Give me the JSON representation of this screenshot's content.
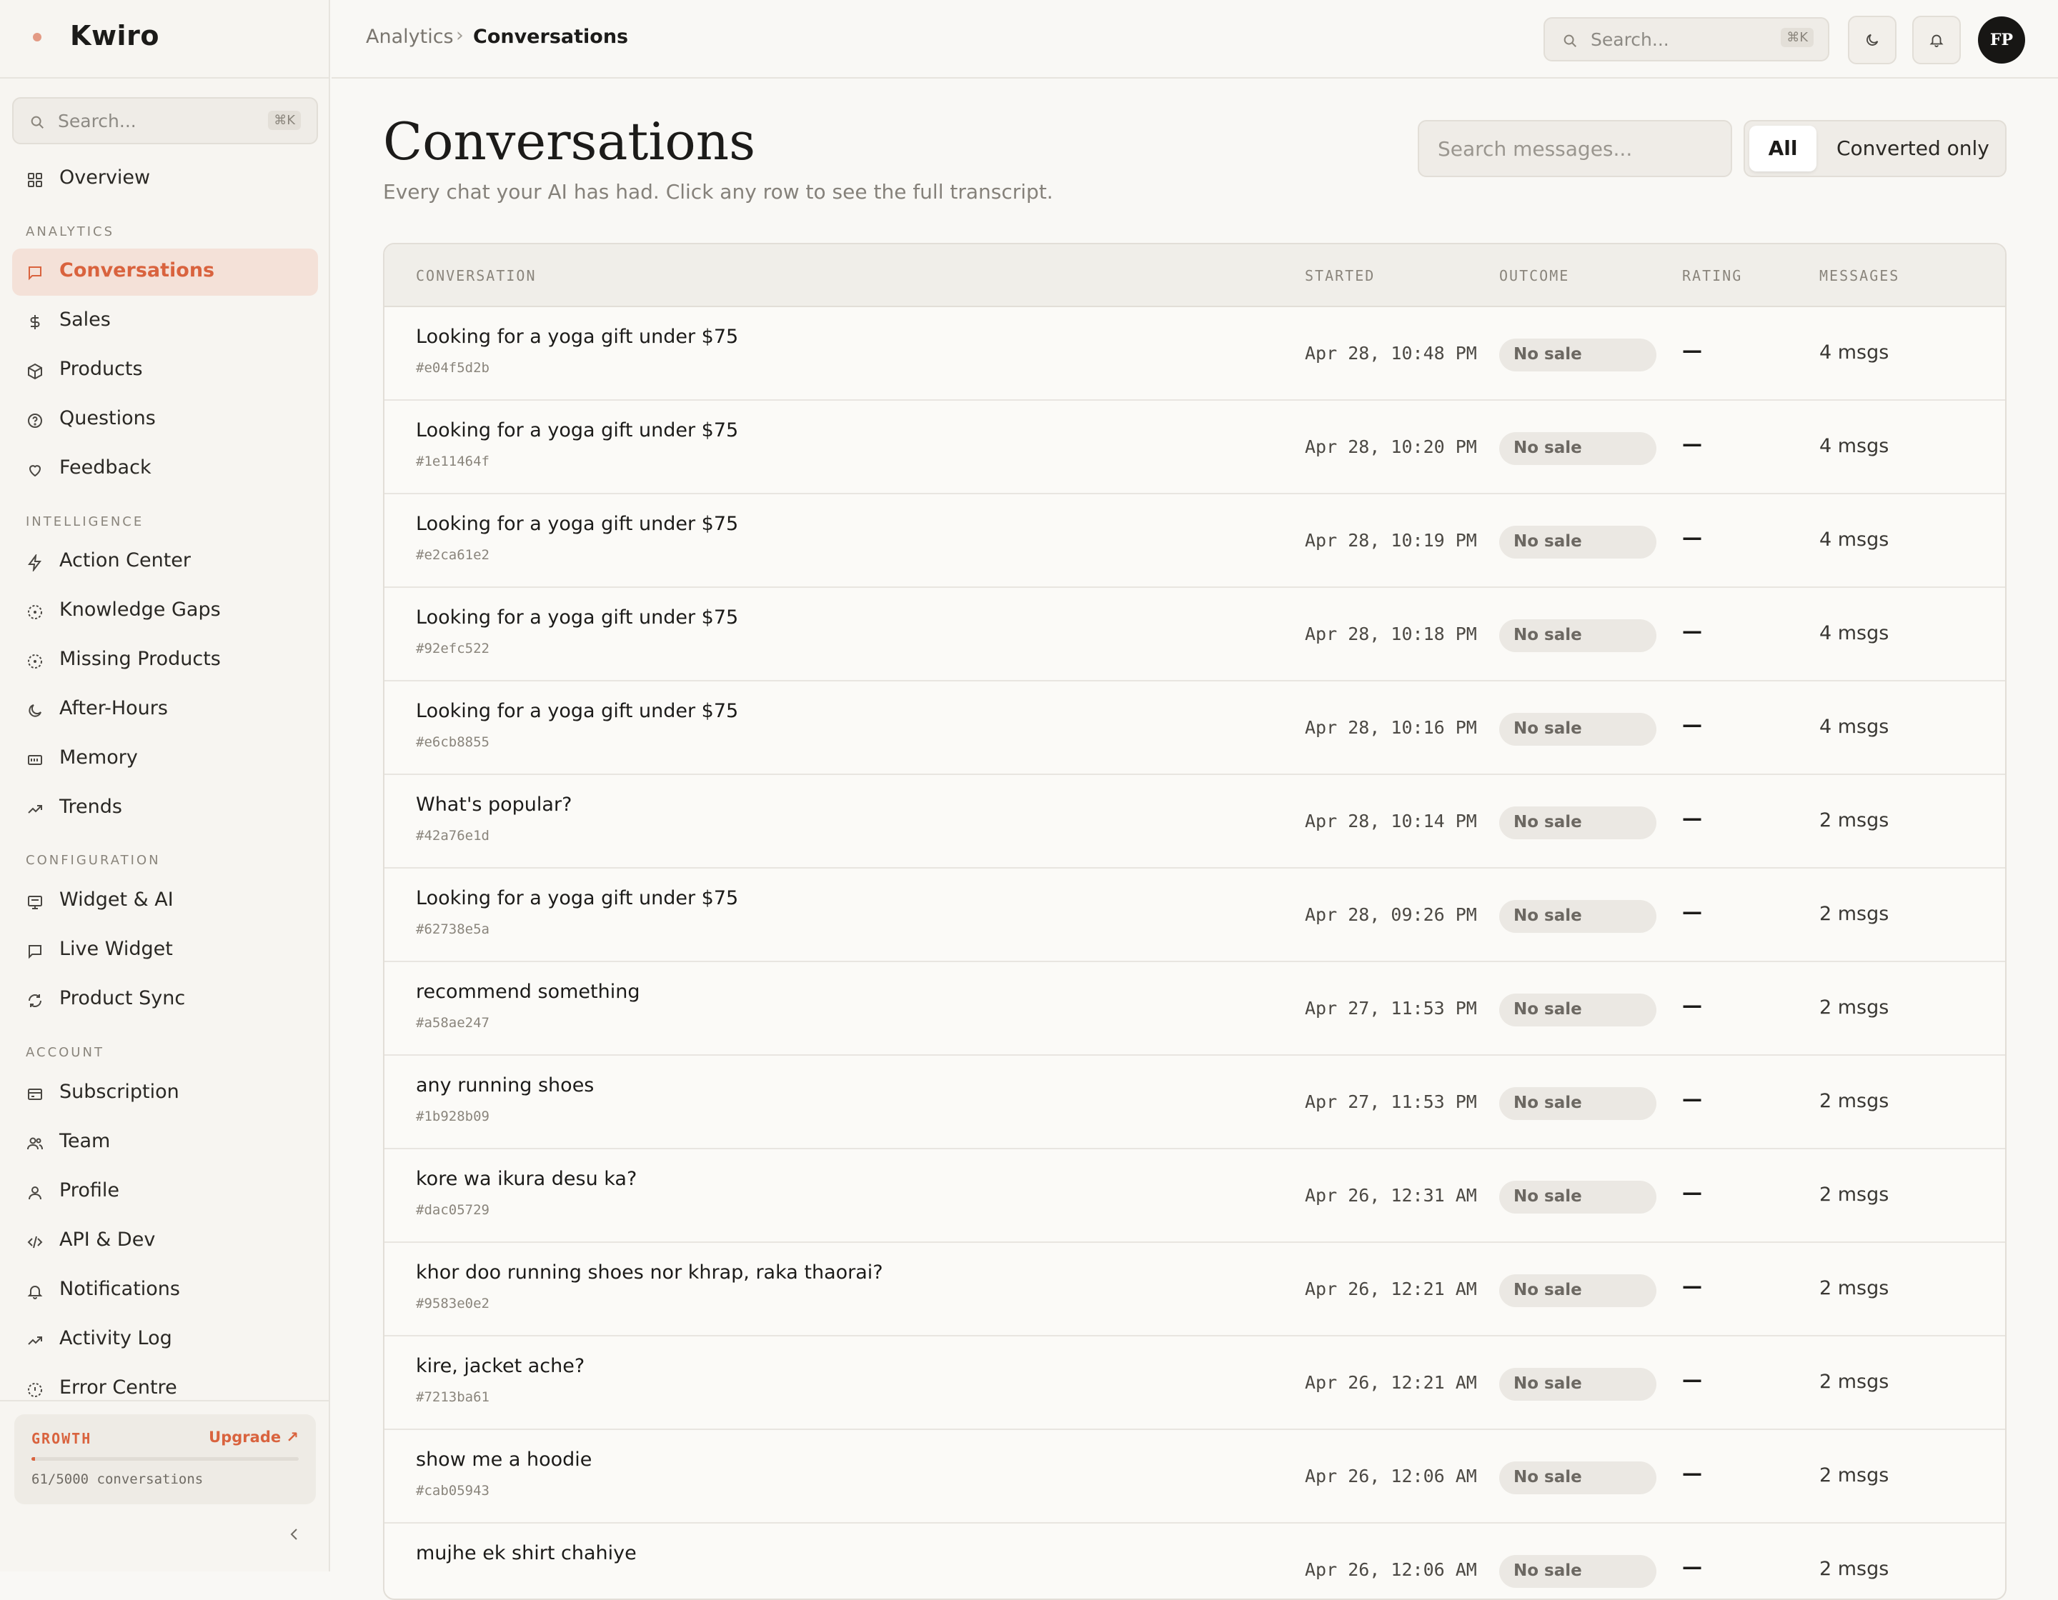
{
  "app": {
    "name": "Kwiro"
  },
  "sidebar": {
    "search": {
      "placeholder": "Search...",
      "shortcut": "⌘K"
    },
    "overview": "Overview",
    "sections": {
      "analytics": "ANALYTICS",
      "intelligence": "INTELLIGENCE",
      "configuration": "CONFIGURATION",
      "account": "ACCOUNT"
    },
    "analytics": [
      {
        "label": "Conversations",
        "icon": "message-icon"
      },
      {
        "label": "Sales",
        "icon": "dollar-icon"
      },
      {
        "label": "Products",
        "icon": "box-icon"
      },
      {
        "label": "Questions",
        "icon": "help-circle-icon"
      },
      {
        "label": "Feedback",
        "icon": "heart-icon"
      }
    ],
    "intelligence": [
      {
        "label": "Action Center",
        "icon": "bolt-icon"
      },
      {
        "label": "Knowledge Gaps",
        "icon": "gap-circle-icon"
      },
      {
        "label": "Missing Products",
        "icon": "gap-circle-icon"
      },
      {
        "label": "After-Hours",
        "icon": "moon-icon"
      },
      {
        "label": "Memory",
        "icon": "memory-icon"
      },
      {
        "label": "Trends",
        "icon": "trend-icon"
      }
    ],
    "configuration": [
      {
        "label": "Widget & AI",
        "icon": "widget-icon"
      },
      {
        "label": "Live Widget",
        "icon": "message-icon"
      },
      {
        "label": "Product Sync",
        "icon": "sync-icon"
      }
    ],
    "account": [
      {
        "label": "Subscription",
        "icon": "card-icon"
      },
      {
        "label": "Team",
        "icon": "users-icon"
      },
      {
        "label": "Profile",
        "icon": "user-icon"
      },
      {
        "label": "API & Dev",
        "icon": "code-icon"
      },
      {
        "label": "Notifications",
        "icon": "bell-icon"
      },
      {
        "label": "Activity Log",
        "icon": "trend-icon"
      },
      {
        "label": "Error Centre",
        "icon": "alert-icon"
      }
    ],
    "plan": {
      "name": "GROWTH",
      "upgrade": "Upgrade ↗",
      "usage": "61/5000 conversations",
      "usage_fraction": 0.0122
    }
  },
  "topbar": {
    "breadcrumb": {
      "parent": "Analytics",
      "separator": "›",
      "current": "Conversations"
    },
    "search": {
      "placeholder": "Search...",
      "shortcut": "⌘K"
    },
    "avatar": "FP"
  },
  "main": {
    "title": "Conversations",
    "subtitle": "Every chat your AI has had. Click any row to see the full transcript.",
    "message_search": {
      "placeholder": "Search messages..."
    },
    "filter": {
      "all": "All",
      "converted": "Converted only",
      "selected": "All"
    }
  },
  "table": {
    "columns": {
      "conversation": "CONVERSATION",
      "started": "STARTED",
      "outcome": "OUTCOME",
      "rating": "RATING",
      "messages": "MESSAGES"
    },
    "rows": [
      {
        "title": "Looking for a yoga gift under $75",
        "id": "#e04f5d2b",
        "started": "Apr 28, 10:48 PM",
        "outcome": "No sale",
        "rating": "—",
        "messages": "4 msgs"
      },
      {
        "title": "Looking for a yoga gift under $75",
        "id": "#1e11464f",
        "started": "Apr 28, 10:20 PM",
        "outcome": "No sale",
        "rating": "—",
        "messages": "4 msgs"
      },
      {
        "title": "Looking for a yoga gift under $75",
        "id": "#e2ca61e2",
        "started": "Apr 28, 10:19 PM",
        "outcome": "No sale",
        "rating": "—",
        "messages": "4 msgs"
      },
      {
        "title": "Looking for a yoga gift under $75",
        "id": "#92efc522",
        "started": "Apr 28, 10:18 PM",
        "outcome": "No sale",
        "rating": "—",
        "messages": "4 msgs"
      },
      {
        "title": "Looking for a yoga gift under $75",
        "id": "#e6cb8855",
        "started": "Apr 28, 10:16 PM",
        "outcome": "No sale",
        "rating": "—",
        "messages": "4 msgs"
      },
      {
        "title": "What's popular?",
        "id": "#42a76e1d",
        "started": "Apr 28, 10:14 PM",
        "outcome": "No sale",
        "rating": "—",
        "messages": "2 msgs"
      },
      {
        "title": "Looking for a yoga gift under $75",
        "id": "#62738e5a",
        "started": "Apr 28, 09:26 PM",
        "outcome": "No sale",
        "rating": "—",
        "messages": "2 msgs"
      },
      {
        "title": "recommend something",
        "id": "#a58ae247",
        "started": "Apr 27, 11:53 PM",
        "outcome": "No sale",
        "rating": "—",
        "messages": "2 msgs"
      },
      {
        "title": "any running shoes",
        "id": "#1b928b09",
        "started": "Apr 27, 11:53 PM",
        "outcome": "No sale",
        "rating": "—",
        "messages": "2 msgs"
      },
      {
        "title": "kore wa ikura desu ka?",
        "id": "#dac05729",
        "started": "Apr 26, 12:31 AM",
        "outcome": "No sale",
        "rating": "—",
        "messages": "2 msgs"
      },
      {
        "title": "khor doo running shoes nor khrap, raka thaorai?",
        "id": "#9583e0e2",
        "started": "Apr 26, 12:21 AM",
        "outcome": "No sale",
        "rating": "—",
        "messages": "2 msgs"
      },
      {
        "title": "kire, jacket ache?",
        "id": "#7213ba61",
        "started": "Apr 26, 12:21 AM",
        "outcome": "No sale",
        "rating": "—",
        "messages": "2 msgs"
      },
      {
        "title": "show me a hoodie",
        "id": "#cab05943",
        "started": "Apr 26, 12:06 AM",
        "outcome": "No sale",
        "rating": "—",
        "messages": "2 msgs"
      },
      {
        "title": "mujhe ek shirt chahiye",
        "id": "",
        "started": "Apr 26, 12:06 AM",
        "outcome": "No sale",
        "rating": "—",
        "messages": "2 msgs"
      }
    ]
  },
  "colors": {
    "accent": "#d9633e",
    "active_bg": "#f4e1d8",
    "background": "#f9f8f5"
  }
}
